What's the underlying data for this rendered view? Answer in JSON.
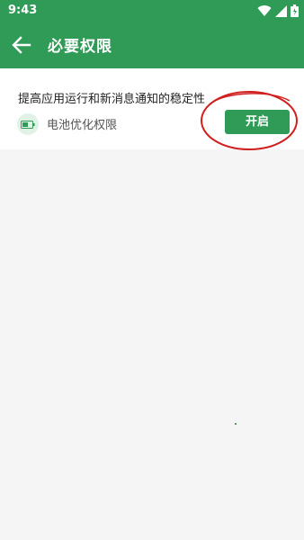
{
  "status_bar": {
    "time": "9:43",
    "icons": [
      "wifi-icon",
      "signal-icon",
      "battery-icon"
    ]
  },
  "app_bar": {
    "title": "必要权限",
    "back_icon": "back-arrow-icon"
  },
  "permission_card": {
    "description": "提高应用运行和新消息通知的稳定性",
    "permission_icon": "battery-icon",
    "permission_label": "电池优化权限",
    "button_label": "开启"
  },
  "colors": {
    "primary": "#2f9b57",
    "annotation": "#d11f1f",
    "background": "#f5f5f5"
  }
}
